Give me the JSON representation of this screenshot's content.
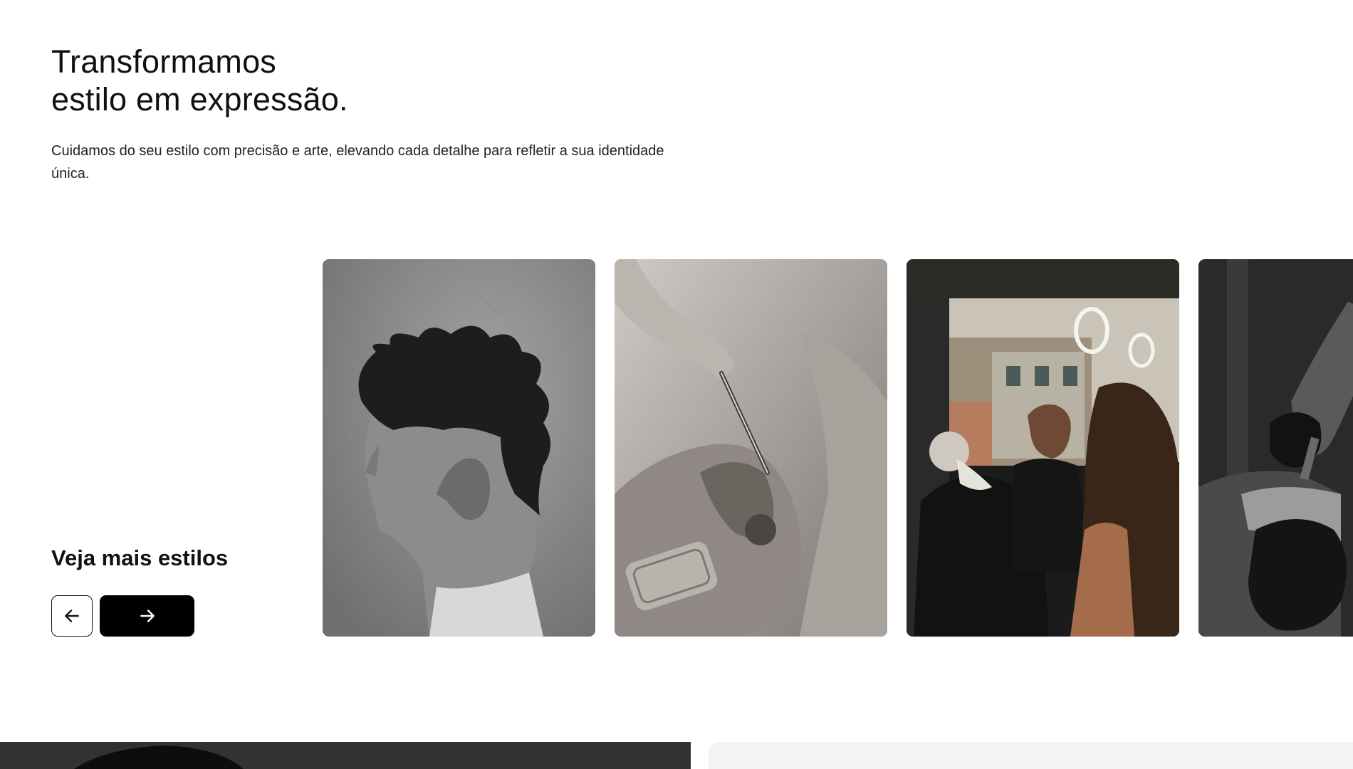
{
  "hero": {
    "headline_line1": "Transformamos",
    "headline_line2": "estilo em expressão.",
    "intro": "Cuidamos do seu estilo com precisão e arte, elevando cada detalhe para refletir a sua identidade única."
  },
  "gallery": {
    "section_title": "Veja mais estilos",
    "prev_icon": "arrow-left-icon",
    "next_icon": "arrow-right-icon",
    "cards": [
      {
        "subject": "haircut-profile"
      },
      {
        "subject": "beard-trim-closeup"
      },
      {
        "subject": "barbershop-interior"
      },
      {
        "subject": "tattoo-artist"
      }
    ]
  },
  "colors": {
    "text": "#111111",
    "button_dark": "#000000",
    "button_light": "#ffffff",
    "panel_light": "#f2f3f5"
  }
}
